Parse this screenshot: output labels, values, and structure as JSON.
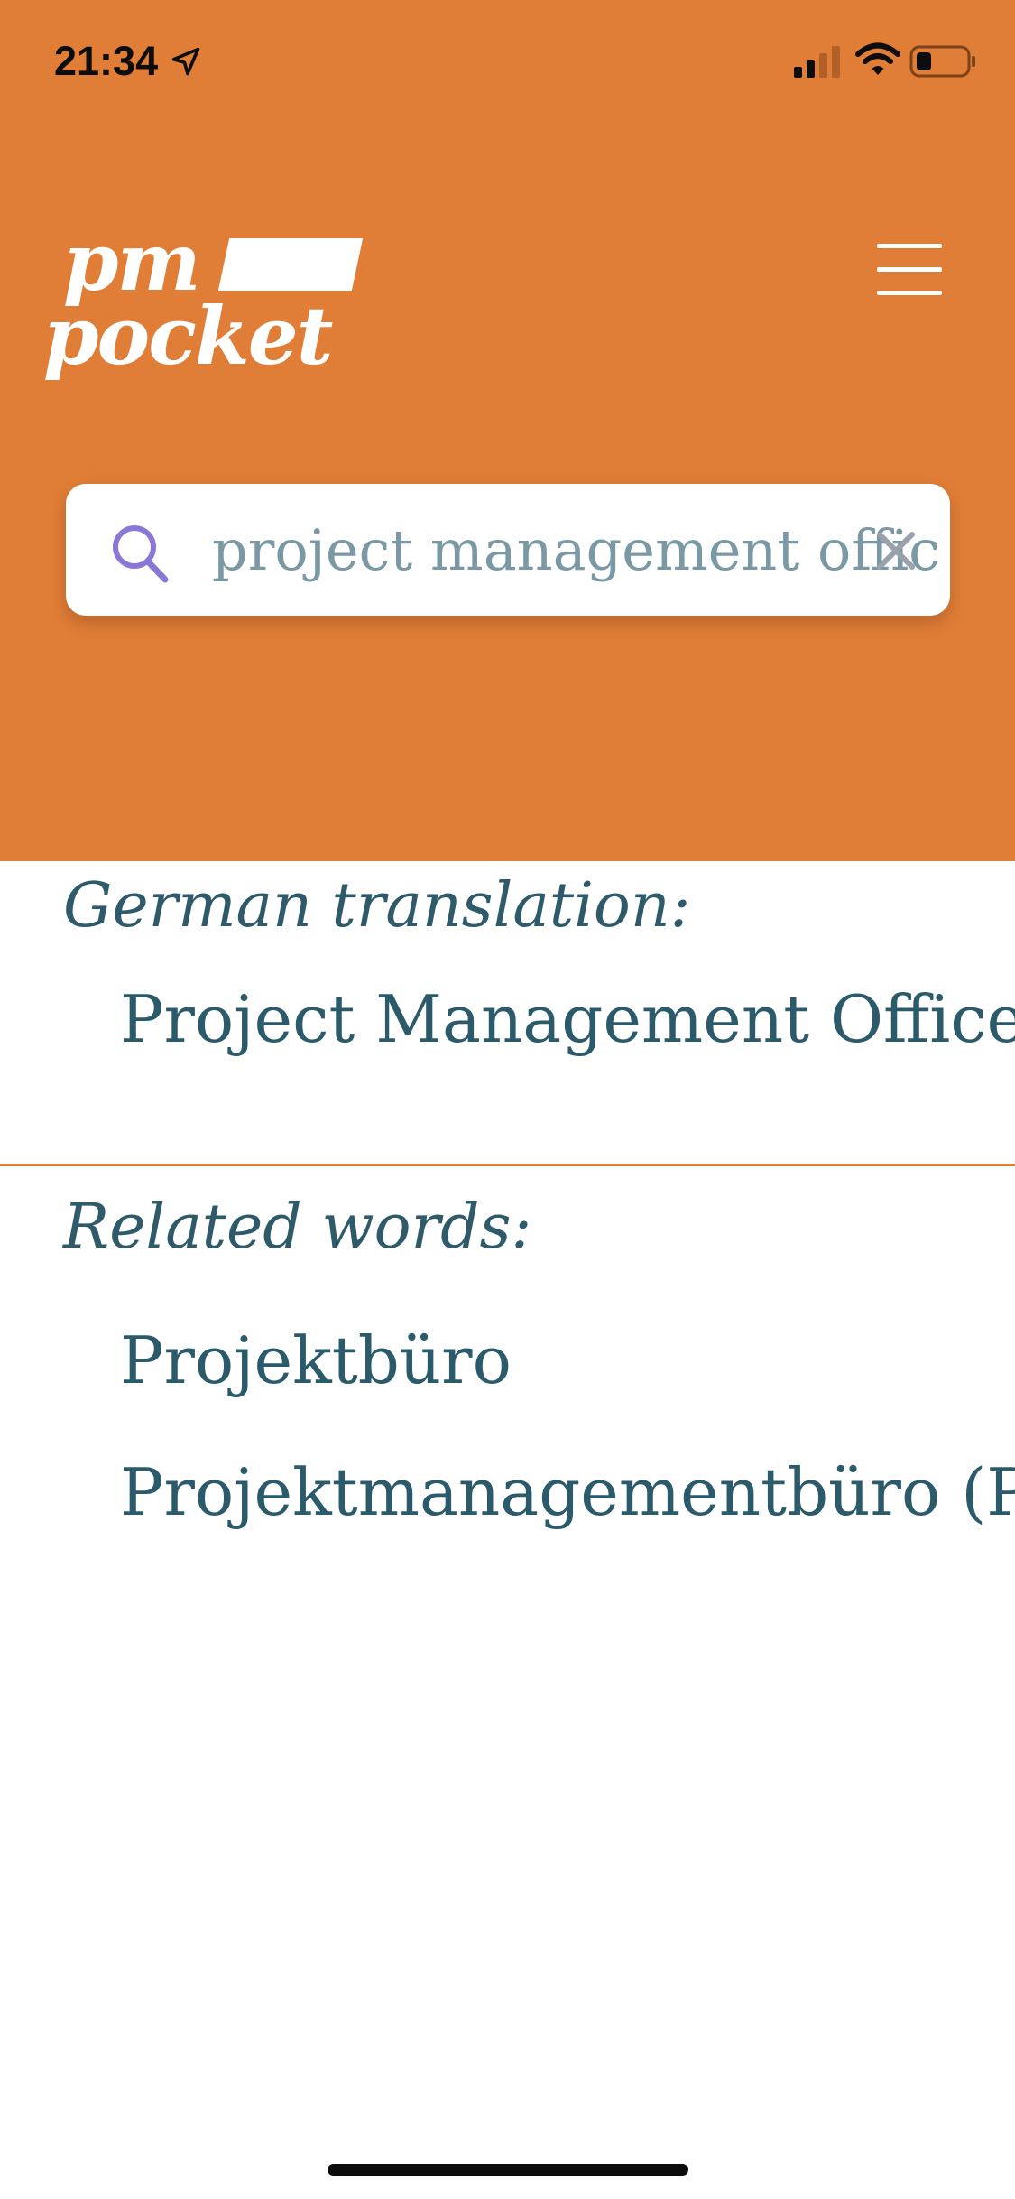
{
  "colors": {
    "brand": "#e07d36",
    "text_primary": "#2b5a6b",
    "divider": "#e07d36"
  },
  "status_bar": {
    "time": "21:34",
    "icons": [
      "location-arrow-icon",
      "cellular-signal-icon",
      "wifi-icon",
      "battery-icon"
    ]
  },
  "header": {
    "logo_line1": "pm",
    "logo_line2": "pocket",
    "menu_icon": "hamburger-menu-icon"
  },
  "search": {
    "value": "project management office",
    "search_icon": "search-icon",
    "clear_icon": "clear-icon"
  },
  "translation": {
    "heading": "German translation:",
    "value": "Project Management Office (PMO)"
  },
  "related": {
    "heading": "Related words:",
    "items": [
      "Projektbüro",
      "Projektmanagementbüro (PMO)"
    ]
  }
}
